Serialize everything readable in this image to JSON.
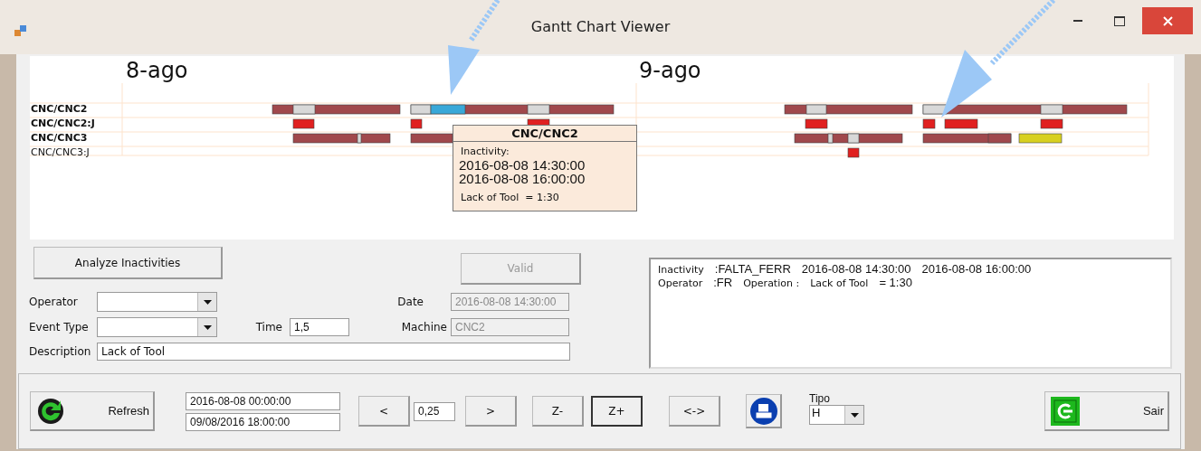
{
  "window": {
    "title": "Gantt Chart Viewer"
  },
  "chart": {
    "dates": [
      "8-ago",
      "9-ago"
    ],
    "rows": [
      {
        "label": "CNC/CNC2",
        "bold": true
      },
      {
        "label": "CNC/CNC2:J",
        "bold": true
      },
      {
        "label": "CNC/CNC3",
        "bold": true
      },
      {
        "label": "CNC/CNC3:J",
        "bold": false
      }
    ],
    "tooltip": {
      "title": "CNC/CNC2",
      "heading": "Inactivity:",
      "start": "2016-08-08 14:30:00",
      "end": "2016-08-08 16:00:00",
      "reason": "Lack of Tool  = 1:30"
    }
  },
  "form": {
    "analyze_button": "Analyze Inactivities",
    "valid_button": {
      "label": "Valid",
      "disabled": true
    },
    "operator": {
      "label": "Operator"
    },
    "event_type": {
      "label": "Event Type"
    },
    "time": {
      "label": "Time",
      "value": "1,5"
    },
    "date": {
      "label": "Date",
      "value": "2016-08-08 14:30:00",
      "disabled": true
    },
    "machine": {
      "label": "Machine",
      "value": "CNC2",
      "disabled": true
    },
    "description": {
      "label": "Description",
      "value": "Lack of Tool"
    }
  },
  "log": {
    "lines": [
      [
        {
          "kind": "label",
          "text": "Inactivity"
        },
        {
          "kind": "value",
          "text": ":FALTA_FERR"
        },
        {
          "kind": "value",
          "text": "2016-08-08 14:30:00"
        },
        {
          "kind": "value",
          "text": "2016-08-08 16:00:00"
        }
      ],
      [
        {
          "kind": "label",
          "text": "Operator"
        },
        {
          "kind": "value",
          "text": ":FR"
        },
        {
          "kind": "label",
          "text": "Operation :"
        },
        {
          "kind": "label",
          "text": "Lack of Tool"
        },
        {
          "kind": "value",
          "text": "= 1:30"
        }
      ]
    ]
  },
  "toolbar": {
    "refresh": "Refresh",
    "start": "2016-08-08 00:00:00",
    "end": "09/08/2016 18:00:00",
    "nav": [
      {
        "label": "<",
        "focused": false
      },
      {
        "kind": "field",
        "label": "0,25"
      },
      {
        "label": ">",
        "focused": false
      },
      {
        "label": "Z-",
        "focused": false
      },
      {
        "label": "Z+",
        "focused": true
      },
      {
        "label": "<->",
        "focused": false
      }
    ],
    "tipo": {
      "label": "Tipo",
      "value": "H"
    },
    "exit": "Sair"
  }
}
